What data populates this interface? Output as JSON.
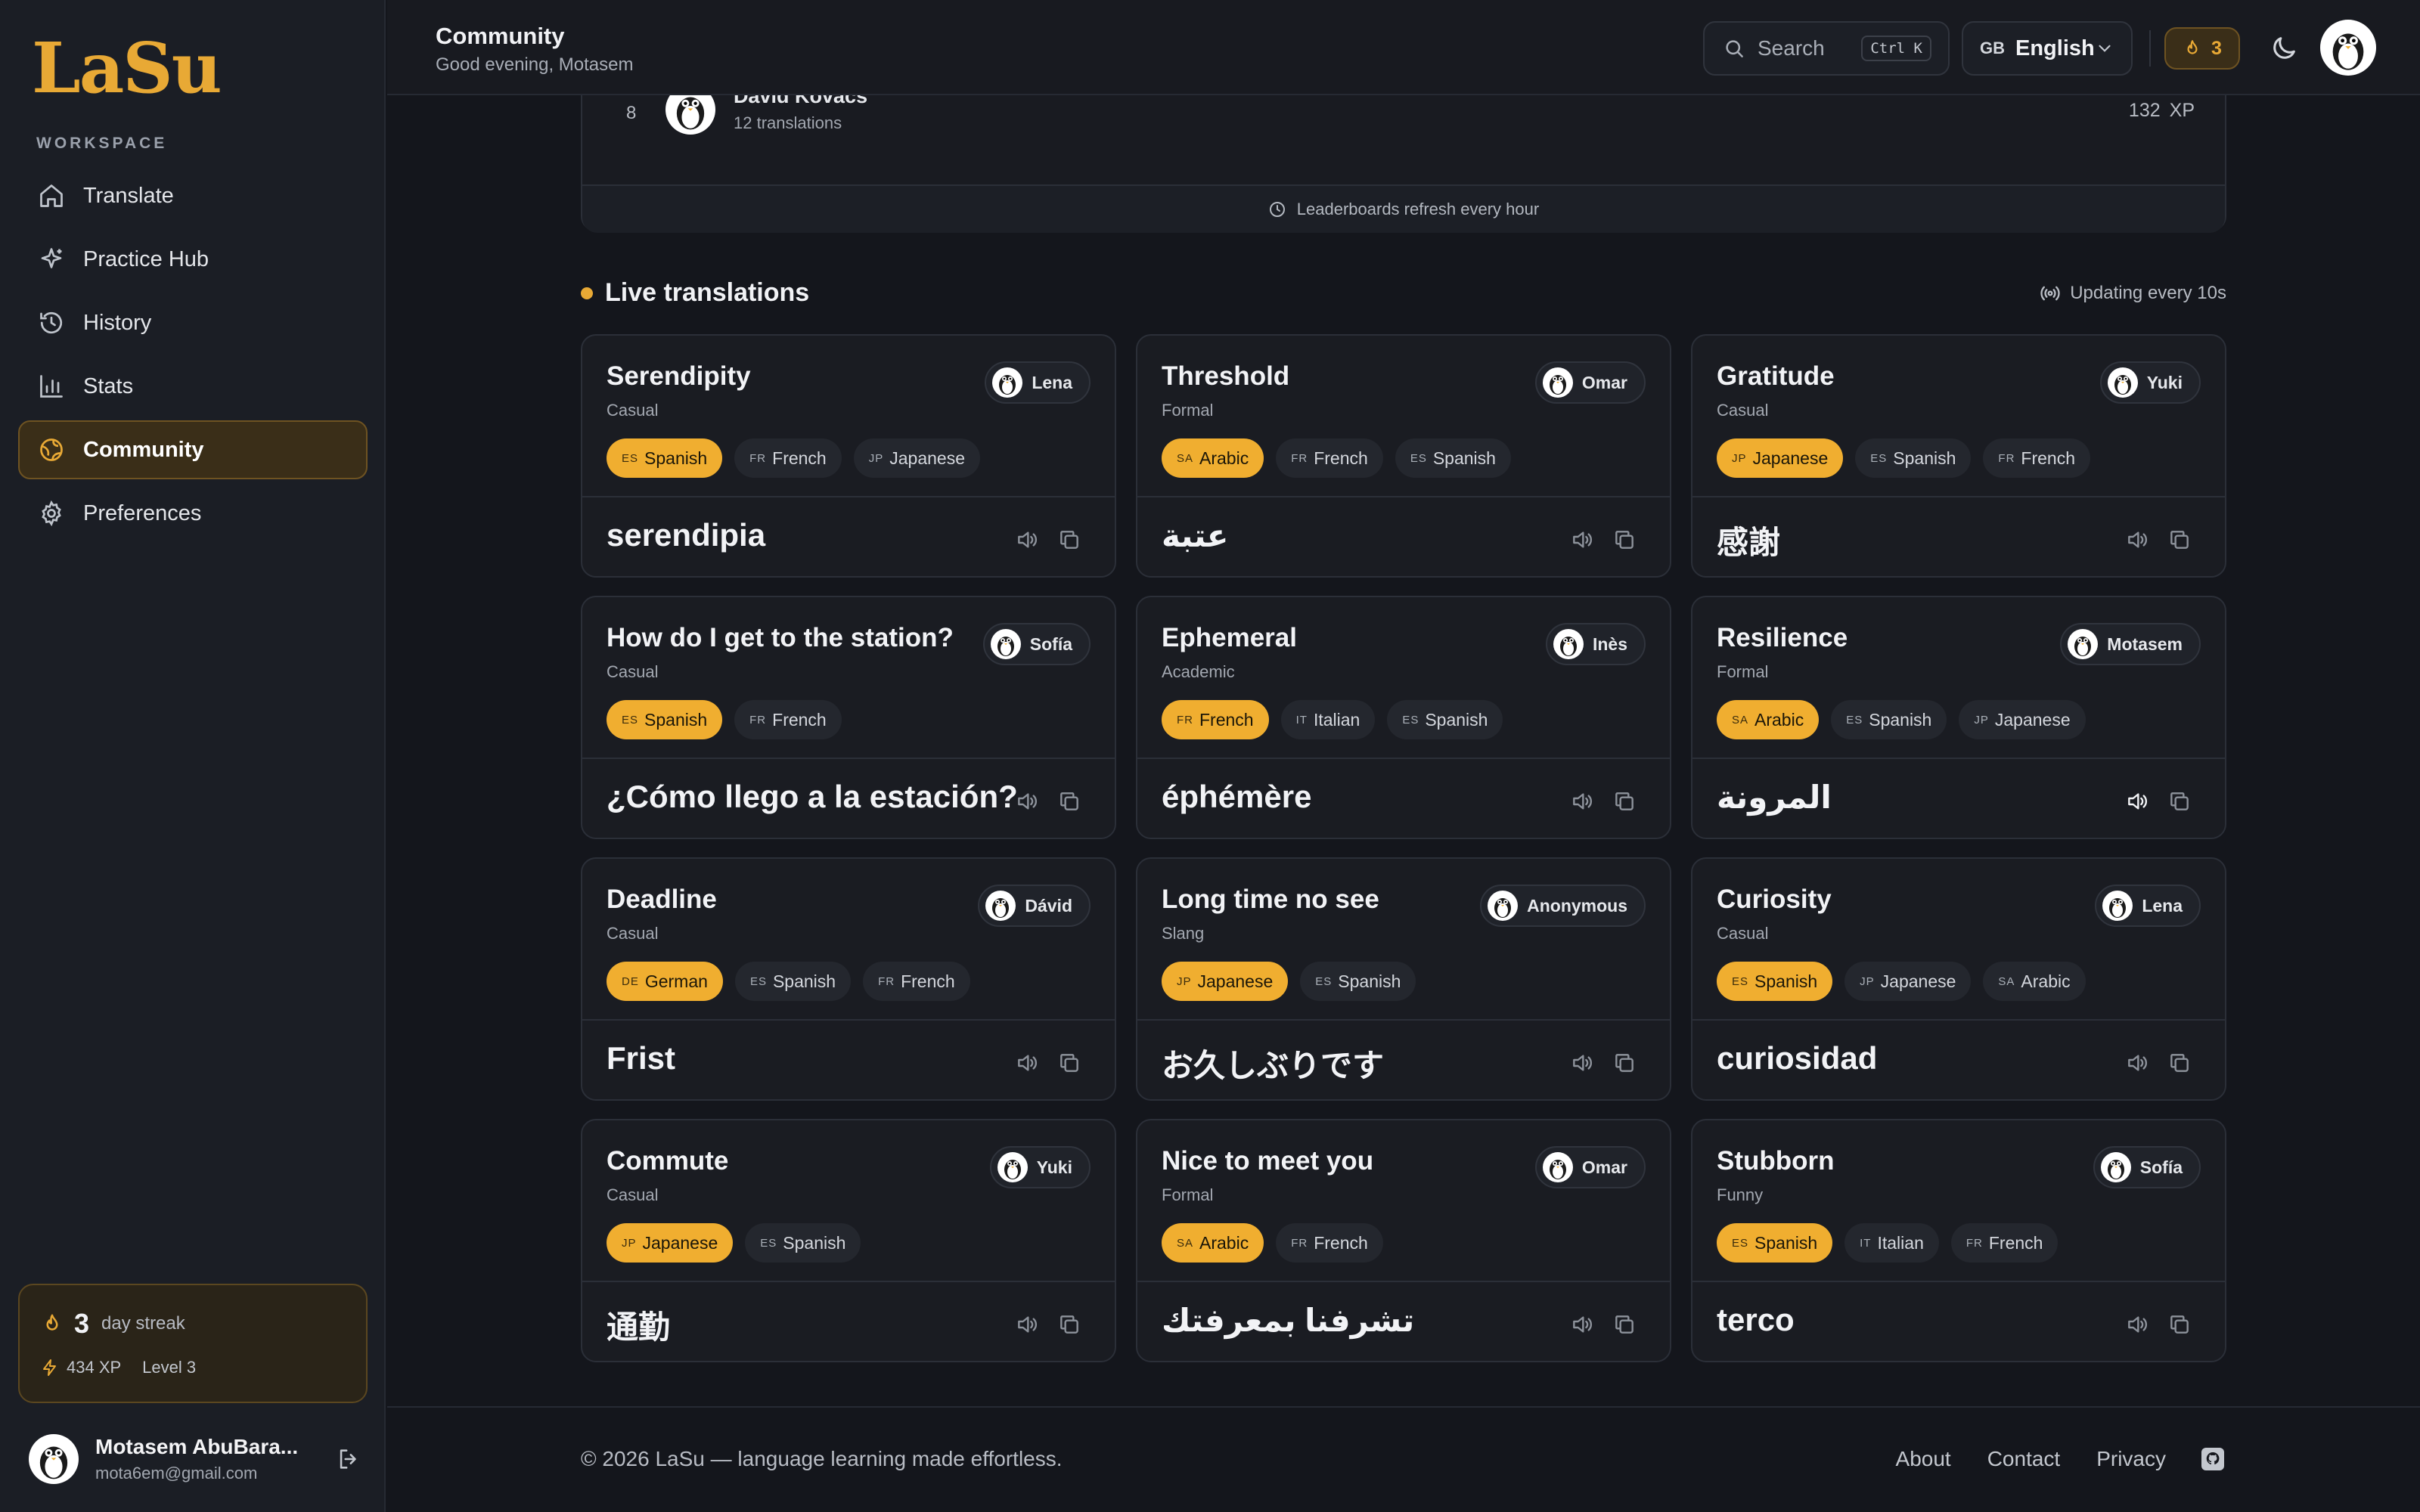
{
  "app": {
    "logo": "LaSu"
  },
  "sidebar": {
    "section_label": "WORKSPACE",
    "items": [
      {
        "label": "Translate",
        "icon": "home-icon"
      },
      {
        "label": "Practice Hub",
        "icon": "sparkle-icon"
      },
      {
        "label": "History",
        "icon": "history-icon"
      },
      {
        "label": "Stats",
        "icon": "bar-chart-icon"
      },
      {
        "label": "Community",
        "icon": "globe-icon",
        "active": true
      },
      {
        "label": "Preferences",
        "icon": "gear-icon"
      }
    ],
    "streak": {
      "days": "3",
      "days_label": "day streak",
      "xp": "434 XP",
      "level": "Level 3"
    },
    "user": {
      "name": "Motasem AbuBara...",
      "email": "mota6em@gmail.com"
    }
  },
  "header": {
    "title": "Community",
    "subtitle": "Good evening, Motasem",
    "search_placeholder": "Search",
    "search_shortcut": "Ctrl K",
    "language_flag": "GB",
    "language": "English",
    "streak_count": "3"
  },
  "leaderboard": {
    "rank": "8",
    "name": "Dávid Kovács",
    "translations": "12 translations",
    "xp_value": "132",
    "xp_unit": "XP",
    "footer_note": "Leaderboards refresh every hour"
  },
  "live": {
    "title": "Live translations",
    "update_note": "Updating every 10s",
    "cards": [
      {
        "word": "Serendipity",
        "tone": "Casual",
        "author": "Lena",
        "langs": [
          {
            "cc": "ES",
            "name": "Spanish"
          },
          {
            "cc": "FR",
            "name": "French"
          },
          {
            "cc": "JP",
            "name": "Japanese"
          }
        ],
        "translation": "serendipia"
      },
      {
        "word": "Threshold",
        "tone": "Formal",
        "author": "Omar",
        "langs": [
          {
            "cc": "SA",
            "name": "Arabic"
          },
          {
            "cc": "FR",
            "name": "French"
          },
          {
            "cc": "ES",
            "name": "Spanish"
          }
        ],
        "translation": "عتبة"
      },
      {
        "word": "Gratitude",
        "tone": "Casual",
        "author": "Yuki",
        "langs": [
          {
            "cc": "JP",
            "name": "Japanese"
          },
          {
            "cc": "ES",
            "name": "Spanish"
          },
          {
            "cc": "FR",
            "name": "French"
          }
        ],
        "translation": "感謝"
      },
      {
        "word": "How do I get to the station?",
        "tone": "Casual",
        "author": "Sofía",
        "langs": [
          {
            "cc": "ES",
            "name": "Spanish"
          },
          {
            "cc": "FR",
            "name": "French"
          }
        ],
        "translation": "¿Cómo llego a la estación?"
      },
      {
        "word": "Ephemeral",
        "tone": "Academic",
        "author": "Inès",
        "langs": [
          {
            "cc": "FR",
            "name": "French"
          },
          {
            "cc": "IT",
            "name": "Italian"
          },
          {
            "cc": "ES",
            "name": "Spanish"
          }
        ],
        "translation": "éphémère"
      },
      {
        "word": "Resilience",
        "tone": "Formal",
        "author": "Motasem",
        "langs": [
          {
            "cc": "SA",
            "name": "Arabic"
          },
          {
            "cc": "ES",
            "name": "Spanish"
          },
          {
            "cc": "JP",
            "name": "Japanese"
          }
        ],
        "translation": "المرونة",
        "speaker_active": true
      },
      {
        "word": "Deadline",
        "tone": "Casual",
        "author": "Dávid",
        "langs": [
          {
            "cc": "DE",
            "name": "German"
          },
          {
            "cc": "ES",
            "name": "Spanish"
          },
          {
            "cc": "FR",
            "name": "French"
          }
        ],
        "translation": "Frist"
      },
      {
        "word": "Long time no see",
        "tone": "Slang",
        "author": "Anonymous",
        "langs": [
          {
            "cc": "JP",
            "name": "Japanese"
          },
          {
            "cc": "ES",
            "name": "Spanish"
          }
        ],
        "translation": "お久しぶりです"
      },
      {
        "word": "Curiosity",
        "tone": "Casual",
        "author": "Lena",
        "langs": [
          {
            "cc": "ES",
            "name": "Spanish"
          },
          {
            "cc": "JP",
            "name": "Japanese"
          },
          {
            "cc": "SA",
            "name": "Arabic"
          }
        ],
        "translation": "curiosidad"
      },
      {
        "word": "Commute",
        "tone": "Casual",
        "author": "Yuki",
        "langs": [
          {
            "cc": "JP",
            "name": "Japanese"
          },
          {
            "cc": "ES",
            "name": "Spanish"
          }
        ],
        "translation": "通勤"
      },
      {
        "word": "Nice to meet you",
        "tone": "Formal",
        "author": "Omar",
        "langs": [
          {
            "cc": "SA",
            "name": "Arabic"
          },
          {
            "cc": "FR",
            "name": "French"
          }
        ],
        "translation": "تشرفنا بمعرفتك"
      },
      {
        "word": "Stubborn",
        "tone": "Funny",
        "author": "Sofía",
        "langs": [
          {
            "cc": "ES",
            "name": "Spanish"
          },
          {
            "cc": "IT",
            "name": "Italian"
          },
          {
            "cc": "FR",
            "name": "French"
          }
        ],
        "translation": "terco"
      }
    ]
  },
  "footer": {
    "copyright": "© 2026 LaSu — language learning made effortless.",
    "links": [
      "About",
      "Contact",
      "Privacy"
    ],
    "github_icon": "github-icon"
  },
  "colors": {
    "accent": "#f0ae30",
    "background": "#14161c",
    "surface": "#1a1c22"
  }
}
